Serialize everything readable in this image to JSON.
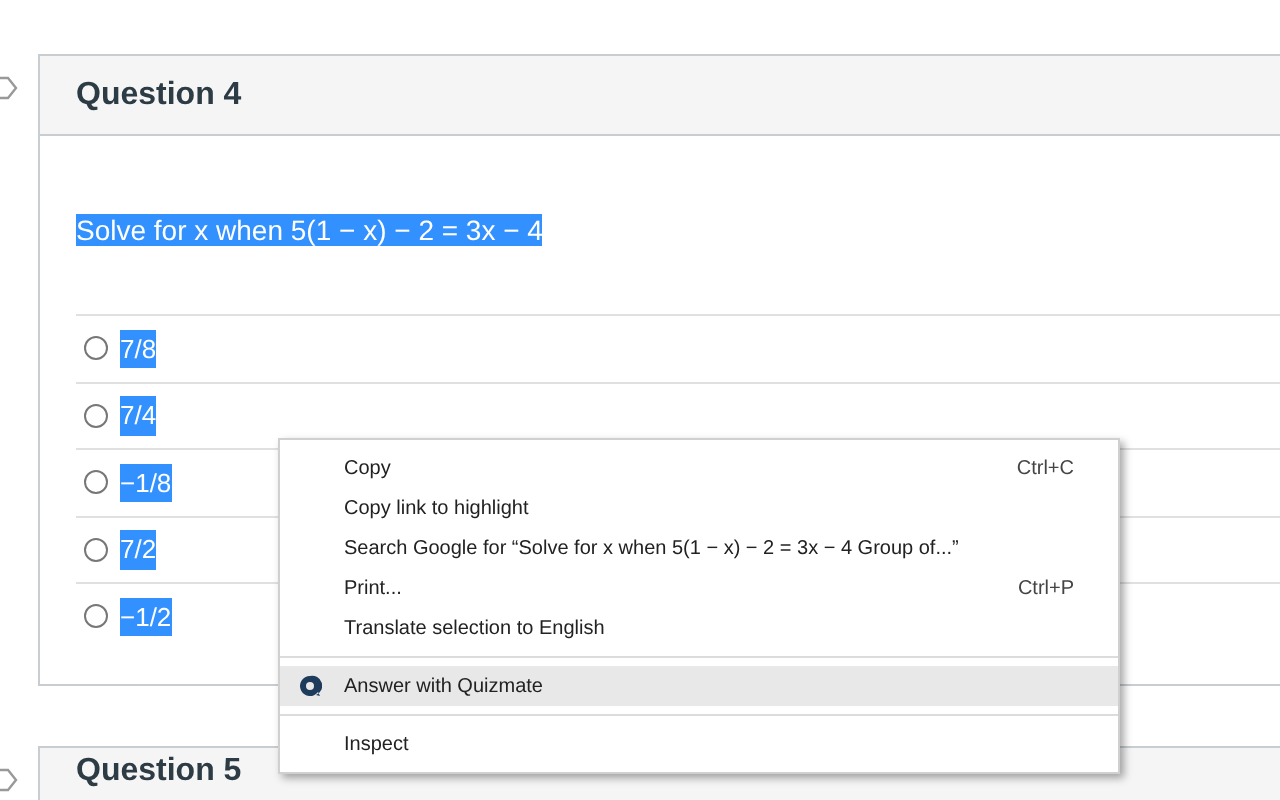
{
  "questions": [
    {
      "title": "Question 4",
      "prompt": "Solve for x when 5(1 − x) − 2 = 3x − 4",
      "prompt_selected": true,
      "answers": [
        {
          "label": "7/8",
          "selected": false
        },
        {
          "label": "7/4",
          "selected": false
        },
        {
          "label": "−1/8",
          "selected": false
        },
        {
          "label": "7/2",
          "selected": false
        },
        {
          "label": "−1/2",
          "selected": false
        }
      ]
    },
    {
      "title": "Question 5"
    }
  ],
  "context_menu": {
    "groups": [
      [
        {
          "label": "Copy",
          "shortcut": "Ctrl+C",
          "highlighted": false
        },
        {
          "label": "Copy link to highlight",
          "highlighted": false
        },
        {
          "label": "Search Google for “Solve for x when 5(1 − x) − 2 = 3x − 4  Group of...”",
          "highlighted": false
        },
        {
          "label": "Print...",
          "shortcut": "Ctrl+P",
          "highlighted": false
        },
        {
          "label": "Translate selection to English",
          "highlighted": false
        }
      ],
      [
        {
          "label": "Answer with Quizmate",
          "kind": "extension",
          "highlighted": true
        }
      ],
      [
        {
          "label": "Inspect",
          "highlighted": false
        }
      ]
    ]
  }
}
